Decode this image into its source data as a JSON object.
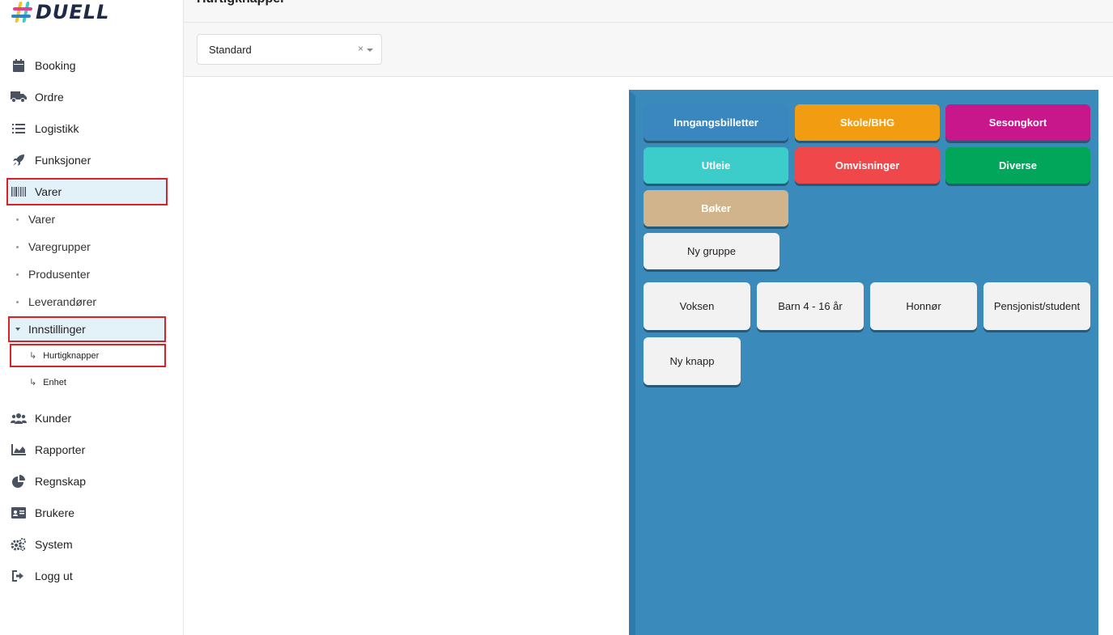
{
  "brand": {
    "name": "DUELL"
  },
  "sidebar": {
    "items": [
      {
        "label": "Booking",
        "icon": "calendar-icon"
      },
      {
        "label": "Ordre",
        "icon": "truck-icon"
      },
      {
        "label": "Logistikk",
        "icon": "list-icon"
      },
      {
        "label": "Funksjoner",
        "icon": "rocket-icon"
      },
      {
        "label": "Varer",
        "icon": "barcode-icon"
      }
    ],
    "varer_sub": [
      "Varer",
      "Varegrupper",
      "Produsenter",
      "Leverandører"
    ],
    "settings": {
      "label": "Innstillinger",
      "children": [
        "Hurtigknapper",
        "Enhet"
      ]
    },
    "items_bottom": [
      {
        "label": "Kunder",
        "icon": "users-icon"
      },
      {
        "label": "Rapporter",
        "icon": "chart-icon"
      },
      {
        "label": "Regnskap",
        "icon": "pie-chart-icon"
      },
      {
        "label": "Brukere",
        "icon": "id-card-icon"
      },
      {
        "label": "System",
        "icon": "cogs-icon"
      },
      {
        "label": "Logg ut",
        "icon": "logout-icon"
      }
    ]
  },
  "header": {
    "title": "Hurtigknapper",
    "select_value": "Standard",
    "clear": "×"
  },
  "panel": {
    "groups": [
      {
        "label": "Inngangsbilletter",
        "color": "#3a86bf"
      },
      {
        "label": "Skole/BHG",
        "color": "#f29c12"
      },
      {
        "label": "Sesongkort",
        "color": "#c8168b"
      },
      {
        "label": "Utleie",
        "color": "#3cccca"
      },
      {
        "label": "Omvisninger",
        "color": "#f0474a"
      },
      {
        "label": "Diverse",
        "color": "#01a65a"
      },
      {
        "label": "Bøker",
        "color": "#d2b48c"
      }
    ],
    "new_group": "Ny gruppe",
    "buttons": [
      "Voksen",
      "Barn 4 - 16 år",
      "Honnør",
      "Pensjonist/student"
    ],
    "new_button": "Ny knapp"
  }
}
